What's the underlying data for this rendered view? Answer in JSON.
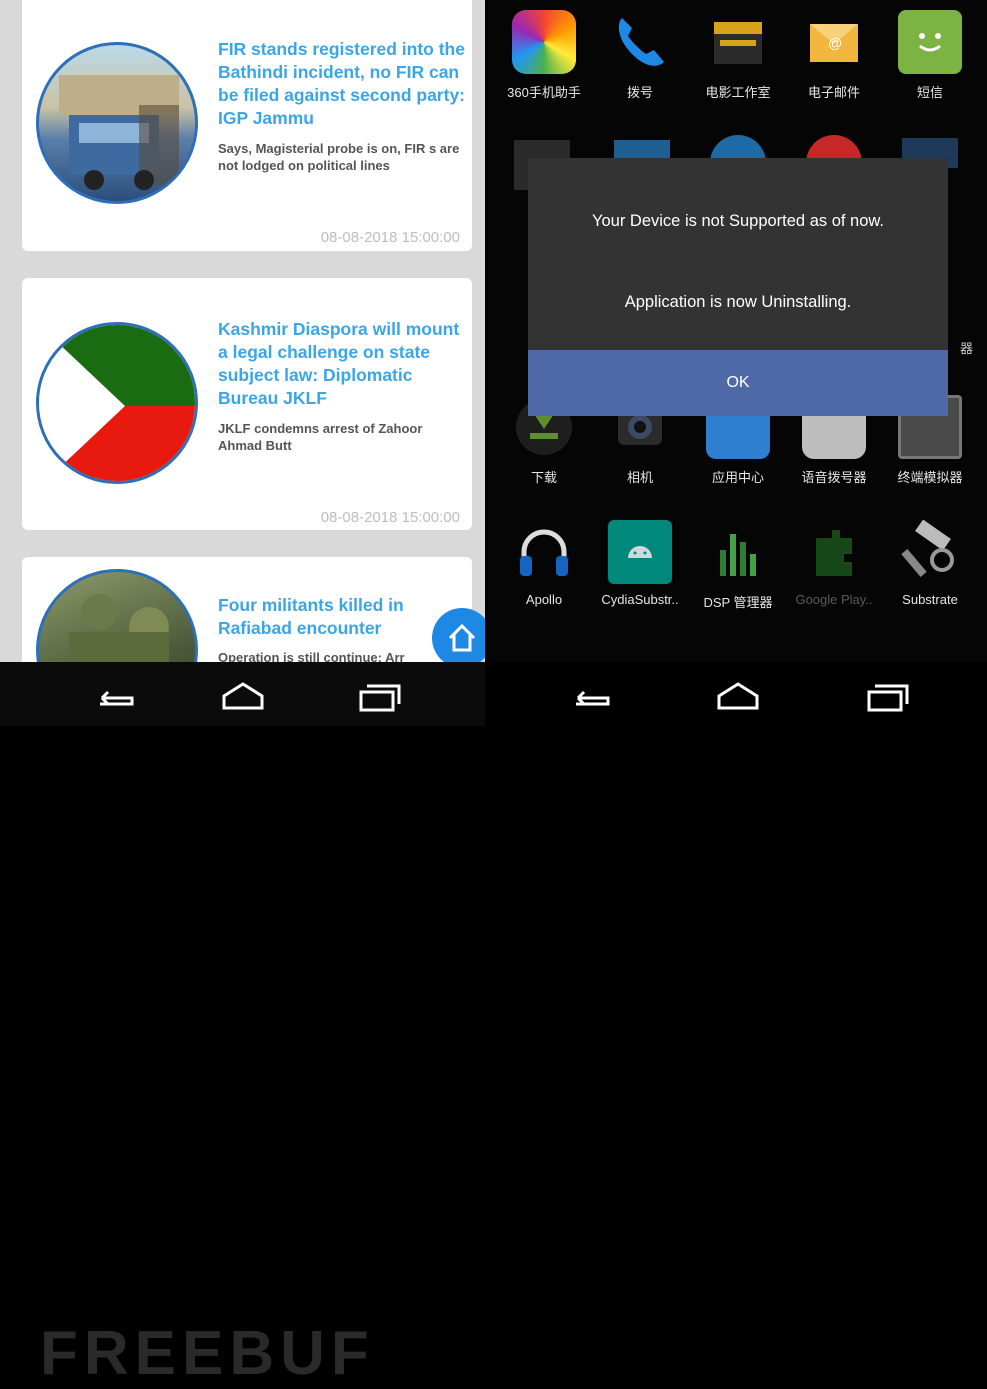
{
  "left_app": {
    "news": [
      {
        "title": "FIR stands registered into the Bathindi incident, no FIR can be filed against second party: IGP Jammu",
        "summary": "Says,  Magisterial probe is on, FIR s are not lodged on political lines",
        "date": "08-08-2018 15:00:00"
      },
      {
        "title": "Kashmir Diaspora will mount a legal challenge on state subject law: Diplomatic Bureau JKLF",
        "summary": "JKLF condemns arrest of Zahoor Ahmad Butt",
        "date": "08-08-2018 15:00:00"
      },
      {
        "title": "Four militants killed in Rafiabad encounter",
        "summary": "Operation is still continue: Arr"
      }
    ],
    "watermark": "FREEBUF"
  },
  "home_screen": {
    "apps": [
      {
        "label": "360手机助手",
        "icon": "360-assistant-icon",
        "color": "#e9a23b"
      },
      {
        "label": "拨号",
        "icon": "phone-icon",
        "color": "#1e88e5"
      },
      {
        "label": "电影工作室",
        "icon": "movie-clapper-icon",
        "color": "#d8a31a"
      },
      {
        "label": "电子邮件",
        "icon": "email-icon",
        "color": "#f0b63e"
      },
      {
        "label": "短信",
        "icon": "sms-icon",
        "color": "#7cb342"
      },
      {
        "label": "下载",
        "icon": "download-icon",
        "color": "#3d6b2a"
      },
      {
        "label": "相机",
        "icon": "camera-icon",
        "color": "#333333"
      },
      {
        "label": "应用中心",
        "icon": "app-center-icon",
        "color": "#2f7fd0"
      },
      {
        "label": "语音拨号器",
        "icon": "voice-dialer-icon",
        "color": "#9e9e9e"
      },
      {
        "label": "终端模拟器",
        "icon": "terminal-emulator-icon",
        "color": "#555555"
      },
      {
        "label": "Apollo",
        "icon": "headphones-icon",
        "color": "#1565c0"
      },
      {
        "label": "CydiaSubstr..",
        "icon": "android-icon",
        "color": "#00897b"
      },
      {
        "label": "DSP 管理器",
        "icon": "equalizer-icon",
        "color": "#2e7d32"
      },
      {
        "label": "Google Play..",
        "icon": "puzzle-icon",
        "color": "#1b5e20"
      },
      {
        "label": "Substrate",
        "icon": "hammer-icon",
        "color": "#9e9e9e"
      }
    ],
    "partial_label": "器"
  },
  "dialog": {
    "message1": "Your Device is not Supported as of now.",
    "message2": "Application is now Uninstalling.",
    "ok_label": "OK"
  }
}
